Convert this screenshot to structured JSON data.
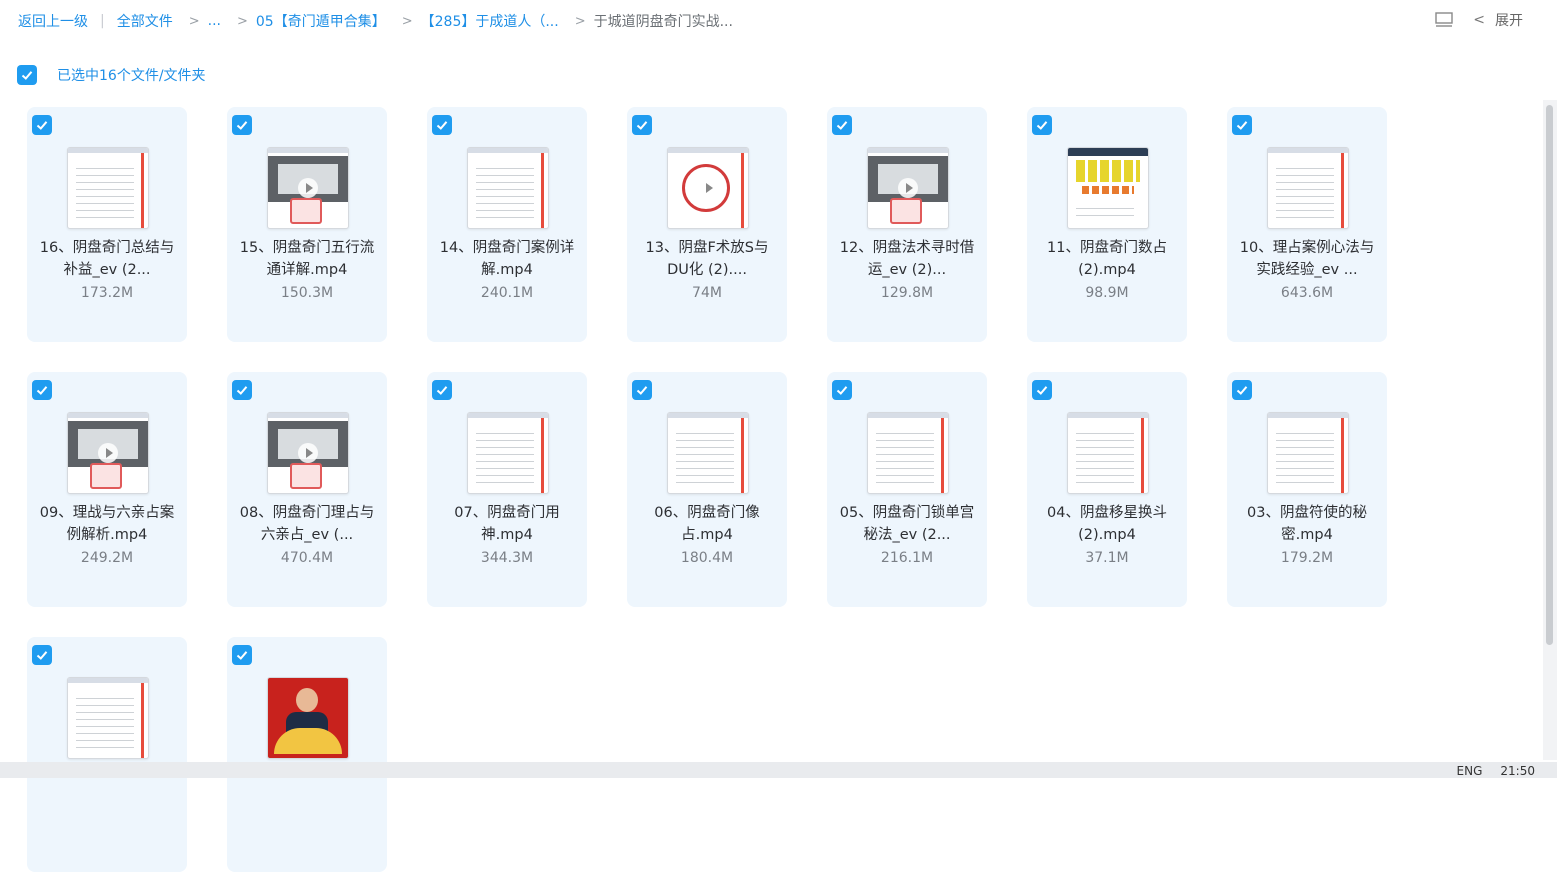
{
  "breadcrumb": {
    "back": "返回上一级",
    "all_files": "全部文件",
    "ellipsis": "...",
    "level1": "05【奇门遁甲合集】",
    "level2": "【285】于成道人（...",
    "current": "于城道阴盘奇门实战..."
  },
  "toolbar": {
    "expand_label": "展开"
  },
  "selection": {
    "text": "已选中16个文件/文件夹"
  },
  "files": [
    {
      "name": "16、阴盘奇门总结与补益_ev (2...",
      "size": "173.2M",
      "thumb": "doc"
    },
    {
      "name": "15、阴盘奇门五行流通详解.mp4",
      "size": "150.3M",
      "thumb": "video"
    },
    {
      "name": "14、阴盘奇门案例详解.mp4",
      "size": "240.1M",
      "thumb": "doc"
    },
    {
      "name": "13、阴盘F术放S与DU化 (2)....",
      "size": "74M",
      "thumb": "circle"
    },
    {
      "name": "12、阴盘法术寻时借运_ev (2)...",
      "size": "129.8M",
      "thumb": "video"
    },
    {
      "name": "11、阴盘奇门数占(2).mp4",
      "size": "98.9M",
      "thumb": "yellow"
    },
    {
      "name": "10、理占案例心法与实践经验_ev ...",
      "size": "643.6M",
      "thumb": "doc"
    },
    {
      "name": "09、理战与六亲占案例解析.mp4",
      "size": "249.2M",
      "thumb": "video"
    },
    {
      "name": "08、阴盘奇门理占与六亲占_ev (...",
      "size": "470.4M",
      "thumb": "video"
    },
    {
      "name": "07、阴盘奇门用神.mp4",
      "size": "344.3M",
      "thumb": "doc"
    },
    {
      "name": "06、阴盘奇门像占.mp4",
      "size": "180.4M",
      "thumb": "doc"
    },
    {
      "name": "05、阴盘奇门锁单宫秘法_ev (2...",
      "size": "216.1M",
      "thumb": "doc"
    },
    {
      "name": "04、阴盘移星换斗(2).mp4",
      "size": "37.1M",
      "thumb": "doc"
    },
    {
      "name": "03、阴盘符使的秘密.mp4",
      "size": "179.2M",
      "thumb": "doc"
    },
    {
      "name": "",
      "size": "",
      "thumb": "doc"
    },
    {
      "name": "",
      "size": "",
      "thumb": "person"
    }
  ],
  "taskbar": {
    "lang": "ENG",
    "time": "21:50"
  },
  "colors": {
    "accent": "#1f9cf0",
    "card_bg": "#eef6fd"
  }
}
